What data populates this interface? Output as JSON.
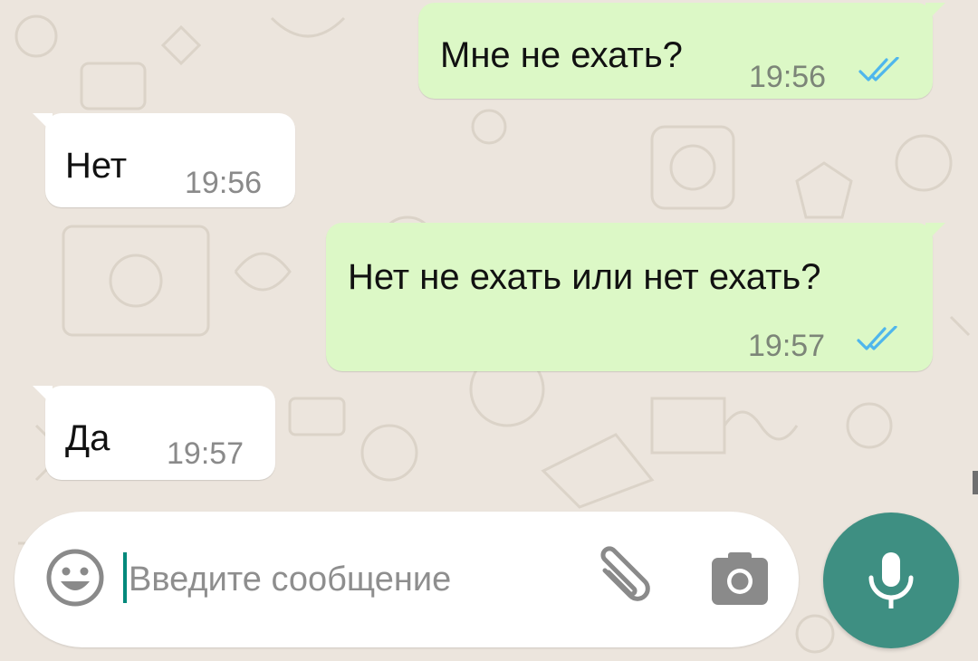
{
  "messages": [
    {
      "direction": "outgoing",
      "text": "Мне не ехать?",
      "time": "19:56",
      "status": "read"
    },
    {
      "direction": "incoming",
      "text": "Нет",
      "time": "19:56"
    },
    {
      "direction": "outgoing",
      "text": "Нет не ехать или нет ехать?",
      "time": "19:57",
      "status": "read"
    },
    {
      "direction": "incoming",
      "text": "Да",
      "time": "19:57"
    }
  ],
  "composer": {
    "placeholder": "Введите сообщение",
    "value": ""
  },
  "icons": {
    "emoji": "emoji-icon",
    "attach": "paperclip-icon",
    "camera": "camera-icon",
    "mic": "mic-icon",
    "read": "double-check-icon"
  },
  "colors": {
    "background": "#ECE5DD",
    "outgoing_bubble": "#DCF8C6",
    "incoming_bubble": "#FFFFFF",
    "read_ticks": "#4FB6EC",
    "accent": "#3E8F82",
    "caret": "#00897B"
  }
}
